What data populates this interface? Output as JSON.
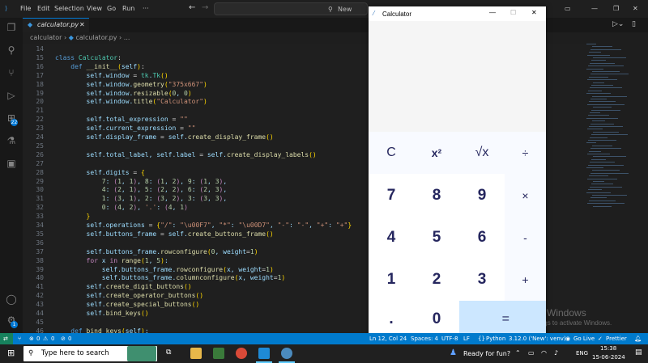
{
  "vscode": {
    "menu": [
      "File",
      "Edit",
      "Selection",
      "View",
      "Go",
      "Run",
      "···"
    ],
    "search_placeholder": "New",
    "tab_label": "calculator.py",
    "breadcrumb": [
      "calculator",
      "calculator.py",
      "..."
    ],
    "activity_badges": [
      "22",
      "1"
    ],
    "code_lines": [
      {
        "n": "14",
        "html": ""
      },
      {
        "n": "15",
        "html": "<span class='kw'>class</span> <span class='cls'>Calculator</span><span class='plain'>:</span>"
      },
      {
        "n": "16",
        "html": "    <span class='kw'>def</span> <span class='fn'>__init__</span><span class='brk'>(</span>self<span class='brk'>)</span><span class='plain'>:</span>"
      },
      {
        "n": "17",
        "html": "        self.window <span class='plain'>=</span> <span class='cls'>tk</span>.<span class='cls'>Tk</span><span class='brk'>()</span>"
      },
      {
        "n": "18",
        "html": "        self.window.<span class='fn'>geometry</span><span class='brk'>(</span><span class='str'>\"375x667\"</span><span class='brk'>)</span>"
      },
      {
        "n": "19",
        "html": "        self.window.<span class='fn'>resizable</span><span class='brk'>(</span><span class='num'>0</span>, <span class='num'>0</span><span class='brk'>)</span>"
      },
      {
        "n": "20",
        "html": "        self.window.<span class='fn'>title</span><span class='brk'>(</span><span class='str'>\"Calculator\"</span><span class='brk'>)</span>"
      },
      {
        "n": "21",
        "html": ""
      },
      {
        "n": "22",
        "html": "        self.total_expression <span class='plain'>=</span> <span class='str'>\"\"</span>"
      },
      {
        "n": "23",
        "html": "        self.current_expression <span class='plain'>=</span> <span class='str'>\"\"</span>"
      },
      {
        "n": "24",
        "html": "        self.display_frame <span class='plain'>=</span> self.<span class='fn'>create_display_frame</span><span class='brk'>()</span>"
      },
      {
        "n": "25",
        "html": ""
      },
      {
        "n": "26",
        "html": "        self.total_label, self.label <span class='plain'>=</span> self.<span class='fn'>create_display_labels</span><span class='brk'>()</span>"
      },
      {
        "n": "27",
        "html": ""
      },
      {
        "n": "28",
        "html": "        self.digits <span class='plain'>=</span> <span class='brk'>{</span>"
      },
      {
        "n": "29",
        "html": "            <span class='num'>7</span>: <span class='ctl'>(</span><span class='num'>1</span>, <span class='num'>1</span><span class='ctl'>)</span>, <span class='num'>8</span>: <span class='ctl'>(</span><span class='num'>1</span>, <span class='num'>2</span><span class='ctl'>)</span>, <span class='num'>9</span>: <span class='ctl'>(</span><span class='num'>1</span>, <span class='num'>3</span><span class='ctl'>)</span>,"
      },
      {
        "n": "30",
        "html": "            <span class='num'>4</span>: <span class='ctl'>(</span><span class='num'>2</span>, <span class='num'>1</span><span class='ctl'>)</span>, <span class='num'>5</span>: <span class='ctl'>(</span><span class='num'>2</span>, <span class='num'>2</span><span class='ctl'>)</span>, <span class='num'>6</span>: <span class='ctl'>(</span><span class='num'>2</span>, <span class='num'>3</span><span class='ctl'>)</span>,"
      },
      {
        "n": "31",
        "html": "            <span class='num'>1</span>: <span class='ctl'>(</span><span class='num'>3</span>, <span class='num'>1</span><span class='ctl'>)</span>, <span class='num'>2</span>: <span class='ctl'>(</span><span class='num'>3</span>, <span class='num'>2</span><span class='ctl'>)</span>, <span class='num'>3</span>: <span class='ctl'>(</span><span class='num'>3</span>, <span class='num'>3</span><span class='ctl'>)</span>,"
      },
      {
        "n": "32",
        "html": "            <span class='num'>0</span>: <span class='ctl'>(</span><span class='num'>4</span>, <span class='num'>2</span><span class='ctl'>)</span>, <span class='str'>'.'</span>: <span class='ctl'>(</span><span class='num'>4</span>, <span class='num'>1</span><span class='ctl'>)</span>"
      },
      {
        "n": "33",
        "html": "        <span class='brk'>}</span>"
      },
      {
        "n": "34",
        "html": "        self.operations <span class='plain'>=</span> <span class='brk'>{</span><span class='str'>\"/\"</span>: <span class='str'>\"\\u00F7\"</span>, <span class='str'>\"*\"</span>: <span class='str'>\"\\u00D7\"</span>, <span class='str'>\"-\"</span>: <span class='str'>\"-\"</span>, <span class='str'>\"+\"</span>: <span class='str'>\"+\"</span><span class='brk'>}</span>"
      },
      {
        "n": "35",
        "html": "        self.buttons_frame <span class='plain'>=</span> self.<span class='fn'>create_buttons_frame</span><span class='brk'>()</span>"
      },
      {
        "n": "36",
        "html": ""
      },
      {
        "n": "37",
        "html": "        self.buttons_frame.<span class='fn'>rowconfigure</span><span class='brk'>(</span><span class='num'>0</span>, weight<span class='plain'>=</span><span class='num'>1</span><span class='brk'>)</span>"
      },
      {
        "n": "38",
        "html": "        <span class='ctl'>for</span> x <span class='ctl'>in</span> <span class='fn'>range</span><span class='brk'>(</span><span class='num'>1</span>, <span class='num'>5</span><span class='brk'>)</span>:"
      },
      {
        "n": "39",
        "html": "            self.buttons_frame.<span class='fn'>rowconfigure</span><span class='brk'>(</span>x, weight<span class='plain'>=</span><span class='num'>1</span><span class='brk'>)</span>"
      },
      {
        "n": "40",
        "html": "            self.buttons_frame.<span class='fn'>columnconfigure</span><span class='brk'>(</span>x, weight<span class='plain'>=</span><span class='num'>1</span><span class='brk'>)</span>"
      },
      {
        "n": "41",
        "html": "        self.<span class='fn'>create_digit_buttons</span><span class='brk'>()</span>"
      },
      {
        "n": "42",
        "html": "        self.<span class='fn'>create_operator_buttons</span><span class='brk'>()</span>"
      },
      {
        "n": "43",
        "html": "        self.<span class='fn'>create_special_buttons</span><span class='brk'>()</span>"
      },
      {
        "n": "44",
        "html": "        self.<span class='fn'>bind_keys</span><span class='brk'>()</span>"
      },
      {
        "n": "45",
        "html": ""
      },
      {
        "n": "46",
        "html": "    <span class='kw'>def</span> <span class='fn'>bind_keys</span><span class='brk'>(</span>self<span class='brk'>)</span>:"
      }
    ],
    "status": {
      "errors": "0",
      "warnings": "0",
      "ports": "0",
      "position": "Ln 12, Col 24",
      "spaces": "Spaces: 4",
      "encoding": "UTF-8",
      "eol": "LF",
      "language": "Python",
      "interpreter": "3.12.0 ('New': venv)",
      "golive": "Go Live",
      "prettier": "Prettier"
    }
  },
  "calculator": {
    "title": "Calculator",
    "special_row": [
      "C",
      "x²",
      "√x",
      "÷"
    ],
    "rows": [
      [
        "7",
        "8",
        "9",
        "×"
      ],
      [
        "4",
        "5",
        "6",
        "-"
      ],
      [
        "1",
        "2",
        "3",
        "+"
      ]
    ],
    "bottom_row": [
      ".",
      "0",
      "="
    ]
  },
  "watermark": {
    "title": "Activate Windows",
    "subtitle": "Go to Settings to activate Windows."
  },
  "taskbar": {
    "search_placeholder": "Type here to search",
    "notification": "Ready for fun?",
    "language": "ENG",
    "time": "15:38",
    "date": "15-06-2024"
  }
}
